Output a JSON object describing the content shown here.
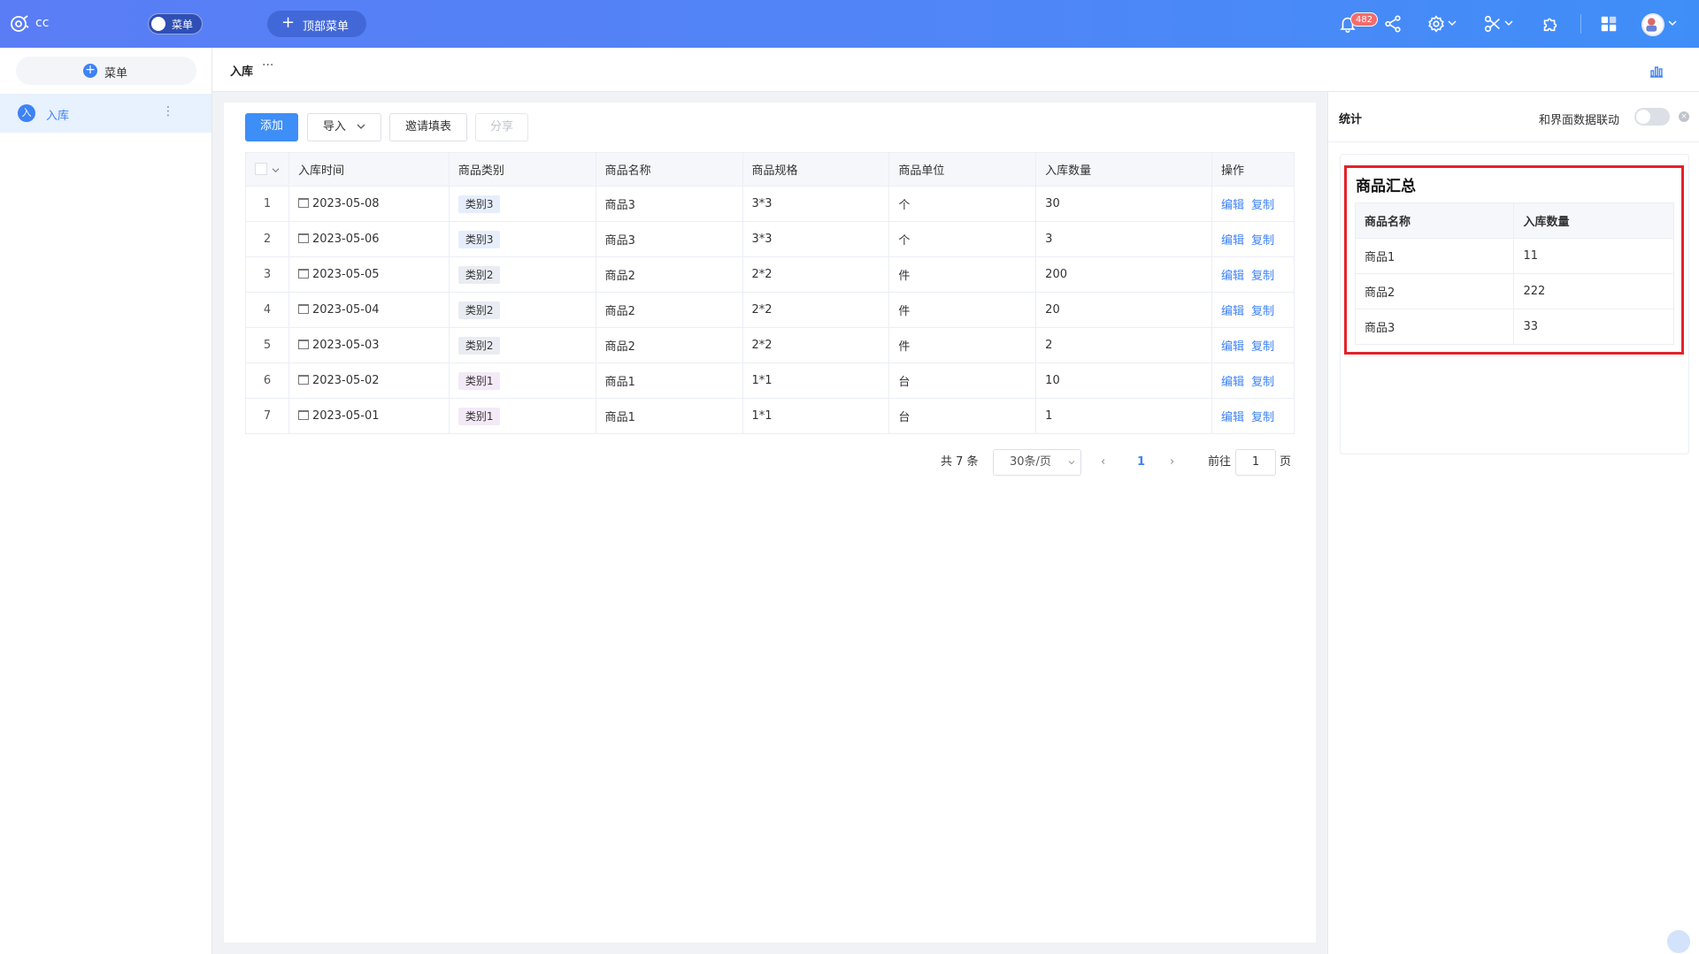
{
  "app": {
    "name": "cc"
  },
  "header": {
    "menu_toggle_label": "菜单",
    "top_menu_label": "顶部菜单",
    "notification_count": "482"
  },
  "sidebar": {
    "menu_button_label": "菜单",
    "items": [
      {
        "avatar": "入",
        "label": "入库"
      }
    ]
  },
  "page": {
    "title": "入库",
    "more": "···"
  },
  "toolbar": {
    "add_label": "添加",
    "import_label": "导入",
    "invite_label": "邀请填表",
    "share_label": "分享"
  },
  "table": {
    "columns": [
      "入库时间",
      "商品类别",
      "商品名称",
      "商品规格",
      "商品单位",
      "入库数量",
      "操作"
    ],
    "rows": [
      {
        "index": "1",
        "date": "2023-05-08",
        "category": "类别3",
        "name": "商品3",
        "spec": "3*3",
        "unit": "个",
        "qty": "30"
      },
      {
        "index": "2",
        "date": "2023-05-06",
        "category": "类别3",
        "name": "商品3",
        "spec": "3*3",
        "unit": "个",
        "qty": "3"
      },
      {
        "index": "3",
        "date": "2023-05-05",
        "category": "类别2",
        "name": "商品2",
        "spec": "2*2",
        "unit": "件",
        "qty": "200"
      },
      {
        "index": "4",
        "date": "2023-05-04",
        "category": "类别2",
        "name": "商品2",
        "spec": "2*2",
        "unit": "件",
        "qty": "20"
      },
      {
        "index": "5",
        "date": "2023-05-03",
        "category": "类别2",
        "name": "商品2",
        "spec": "2*2",
        "unit": "件",
        "qty": "2"
      },
      {
        "index": "6",
        "date": "2023-05-02",
        "category": "类别1",
        "name": "商品1",
        "spec": "1*1",
        "unit": "台",
        "qty": "10"
      },
      {
        "index": "7",
        "date": "2023-05-01",
        "category": "类别1",
        "name": "商品1",
        "spec": "1*1",
        "unit": "台",
        "qty": "1"
      }
    ],
    "actions": {
      "edit": "编辑",
      "copy": "复制"
    },
    "category_colors": {
      "类别1": "#f3e9f7",
      "类别2": "#e9ecf2",
      "类别3": "#e6eefc"
    }
  },
  "pagination": {
    "total": "共 7 条",
    "page_size": "30条/页",
    "current": "1",
    "goto_label": "前往",
    "goto_value": "1",
    "page_suffix": "页"
  },
  "stats": {
    "title": "统计",
    "link_label": "和界面数据联动",
    "link_enabled": false,
    "summary_title": "商品汇总",
    "columns": [
      "商品名称",
      "入库数量"
    ],
    "rows": [
      [
        "商品1",
        "11"
      ],
      [
        "商品2",
        "222"
      ],
      [
        "商品3",
        "33"
      ]
    ]
  },
  "colors": {
    "accent": "#3e82f7",
    "highlight_border": "#e4212a",
    "header_gradient_start": "#5a7df6",
    "header_gradient_end": "#3f8ef8"
  },
  "icons": [
    "logo-icon",
    "bell-icon",
    "share-icon",
    "gear-icon",
    "tools-icon",
    "puzzle-icon",
    "apps-icon",
    "avatar",
    "calendar-icon",
    "chart-icon"
  ]
}
